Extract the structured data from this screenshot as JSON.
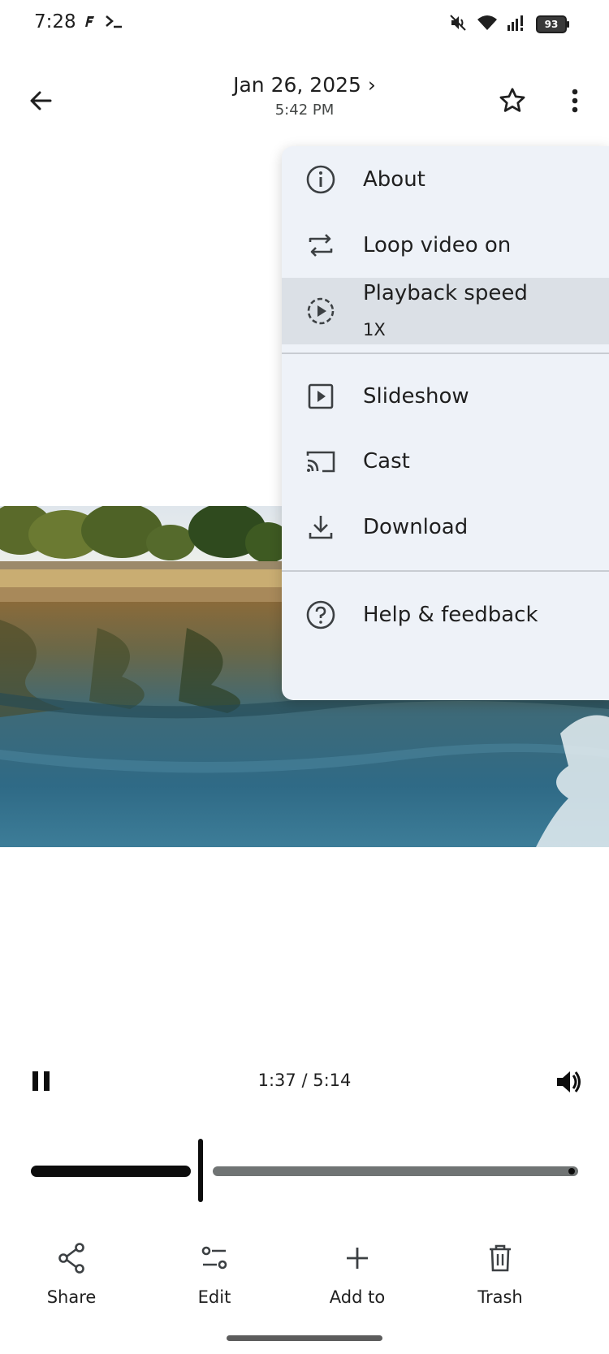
{
  "status_bar": {
    "time": "7:28",
    "battery": "93",
    "icons": [
      "f-app-icon",
      "terminal-icon",
      "mute-icon",
      "wifi-icon",
      "signal-icon",
      "battery-icon"
    ]
  },
  "header": {
    "date": "Jan 26, 2025",
    "chevron": "›",
    "time": "5:42 PM",
    "icons": [
      "back-arrow-icon",
      "star-icon",
      "more-vert-icon"
    ]
  },
  "menu": {
    "items": [
      {
        "label": "About",
        "icon": "info-icon"
      },
      {
        "label": "Loop video on",
        "icon": "repeat-icon"
      },
      {
        "label": "Playback speed",
        "sublabel": "1X",
        "icon": "playback-speed-icon",
        "highlighted": true
      },
      {
        "label": "Slideshow",
        "icon": "slideshow-icon"
      },
      {
        "label": "Cast",
        "icon": "cast-icon"
      },
      {
        "label": "Download",
        "icon": "download-icon"
      },
      {
        "label": "Help & feedback",
        "icon": "help-icon"
      }
    ]
  },
  "player": {
    "time_readout": "1:37 / 5:14",
    "progress_fraction": 0.31,
    "state": "playing"
  },
  "actions": [
    {
      "label": "Share",
      "icon": "share-icon"
    },
    {
      "label": "Edit",
      "icon": "edit-sliders-icon"
    },
    {
      "label": "Add to",
      "icon": "plus-icon"
    },
    {
      "label": "Trash",
      "icon": "trash-icon"
    }
  ],
  "colors": {
    "menu_bg": "#eef2f8",
    "menu_highlight": "#dbe0e6",
    "track_played": "#0d0d0d",
    "track_remaining": "#707474"
  }
}
